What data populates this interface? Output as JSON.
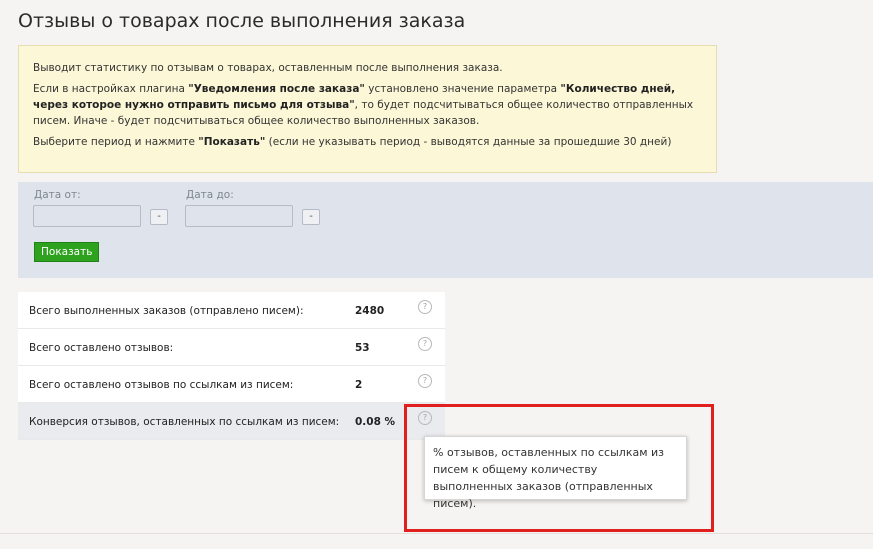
{
  "page": {
    "title": "Отзывы о товарах после выполнения заказа"
  },
  "info": {
    "line1": "Выводит статистику по отзывам о товарах, оставленным после выполнения заказа.",
    "line2_a": "Если в настройках плагина ",
    "line2_b": "\"Уведомления после заказа\"",
    "line2_c": " установлено значение параметра ",
    "line2_d": "\"Количество дней, через которое нужно отправить письмо для отзыва\"",
    "line2_e": ", то будет подсчитываться общее количество отправленных писем. Иначе - будет подсчитываться общее количество выполненных заказов.",
    "line3_a": "Выберите период и нажмите ",
    "line3_b": "\"Показать\"",
    "line3_c": " (если не указывать период - выводятся данные за прошедшие 30 дней)"
  },
  "filter": {
    "date_from_label": "Дата от:",
    "date_to_label": "Дата до:",
    "date_from_value": "",
    "date_to_value": "",
    "clear_label": "-",
    "show_button": "Показать"
  },
  "stats": [
    {
      "label": "Всего выполненных заказов (отправлено писем):",
      "value": "2480"
    },
    {
      "label": "Всего оставлено отзывов:",
      "value": "53"
    },
    {
      "label": "Всего оставлено отзывов по ссылкам из писем:",
      "value": "2"
    },
    {
      "label": "Конверсия отзывов, оставленных по ссылкам из писем:",
      "value": "0.08 %"
    }
  ],
  "help_glyph": "?",
  "tooltip": {
    "text": "% отзывов, оставленных по ссылкам из писем к общему количеству выполненных заказов (отправленных писем)."
  },
  "colors": {
    "highlight_border": "#e0201f",
    "show_button": "#2ea11f",
    "info_background": "#fcf8d7",
    "filter_background": "#dfe4ec"
  }
}
